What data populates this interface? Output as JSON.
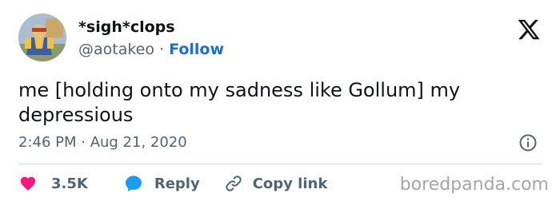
{
  "user": {
    "display_name": "*sigh*clops",
    "handle": "@aotakeo",
    "separator": "·",
    "follow_label": "Follow"
  },
  "tweet": {
    "text": "me [holding onto my sadness like Gollum] my depressious",
    "timestamp": "2:46 PM · Aug 21, 2020"
  },
  "actions": {
    "likes": "3.5K",
    "reply_label": "Reply",
    "copy_label": "Copy link"
  },
  "watermark": "boredpanda.com",
  "colors": {
    "like": "#f91880",
    "reply": "#1d9bf0",
    "follow": "#1d6fc9"
  },
  "icons": [
    "x-logo-icon",
    "info-icon",
    "heart-icon",
    "speech-bubble-icon",
    "link-icon"
  ]
}
